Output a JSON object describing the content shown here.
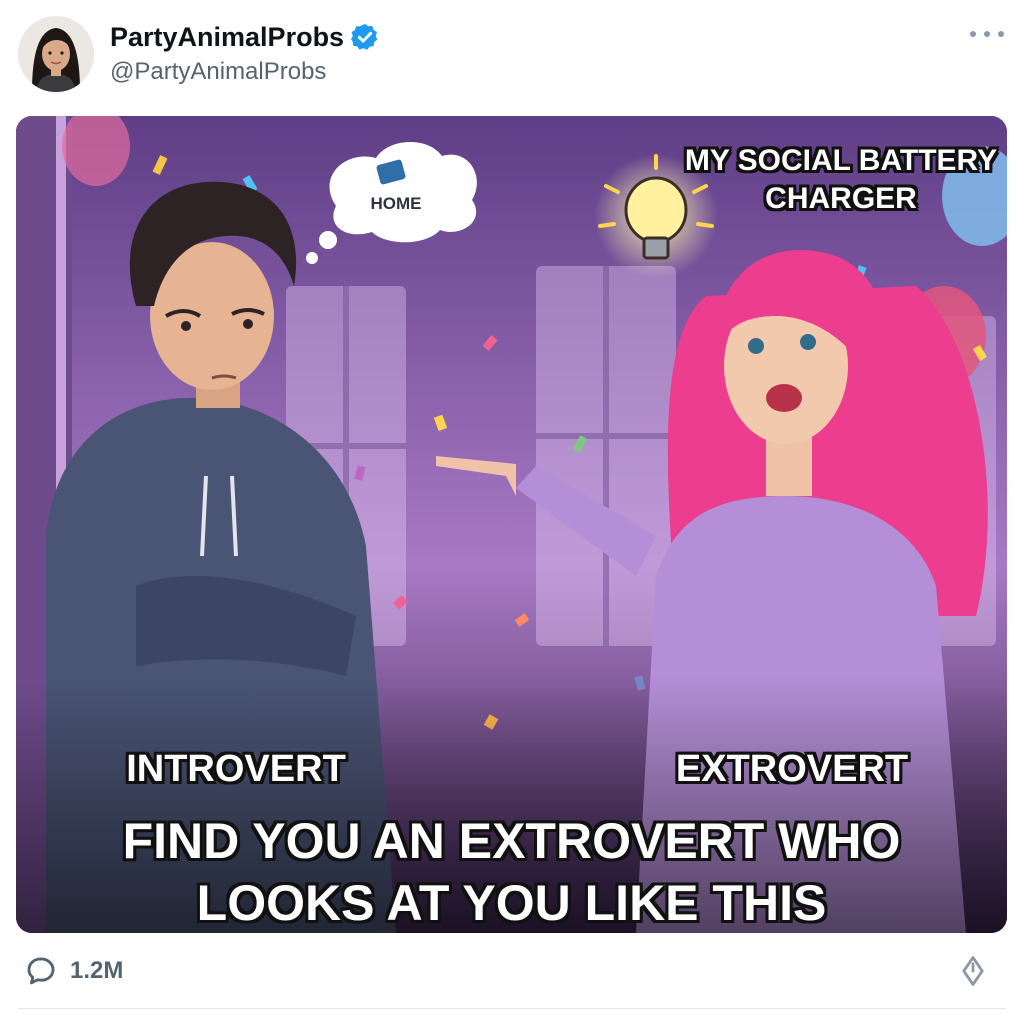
{
  "post": {
    "author": {
      "display_name": "PartyAnimalProbs",
      "handle": "@PartyAnimalProbs",
      "verified": true,
      "avatar_icon": "profile-photo"
    },
    "more_icon": "more-horizontal-icon",
    "image": {
      "thought_bubble": "HOME",
      "caption_battery": "MY SOCIAL BATTERY CHARGER",
      "label_left": "INTROVERT",
      "label_right": "EXTROVERT",
      "caption_main": "FIND YOU AN EXTROVERT WHO LOOKS AT YOU LIKE THIS"
    },
    "actions": {
      "reply_icon": "comment-icon",
      "reply_count": "1.2M",
      "share_icon": "share-icon"
    }
  },
  "colors": {
    "verified_blue": "#1d9bf0",
    "secondary_text": "#536471",
    "scene_purple": "#5d3f82",
    "hair_pink": "#ec3d8f",
    "dress_lilac": "#b48ed6",
    "hoodie_slate": "#4a5475"
  }
}
